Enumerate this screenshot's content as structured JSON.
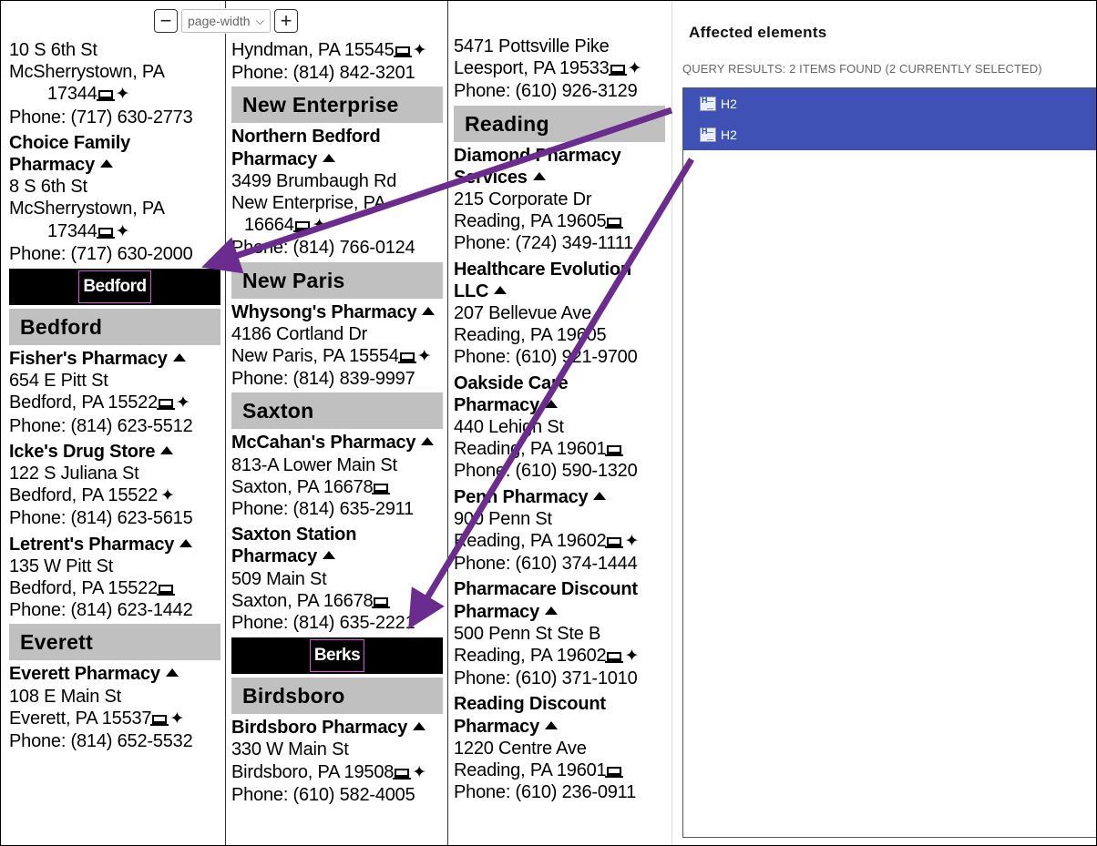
{
  "toolbar": {
    "zoom_out": "−",
    "zoom_value": "page-width",
    "zoom_in": "+"
  },
  "columns": {
    "col1": {
      "pre": [
        [
          "10 S 6th St",
          "",
          ""
        ],
        [
          "McSherrystown, PA",
          "",
          ""
        ],
        [
          "17344",
          "indent",
          "laptop+star"
        ],
        [
          "Phone: (717) 630-2773",
          "",
          ""
        ]
      ],
      "entry_choice": {
        "name1": "Choice Family",
        "name2": "Pharmacy",
        "addr": "8 S 6th St",
        "city": "McSherrystown, PA",
        "zip": "17344",
        "phone": "Phone: (717) 630-2000"
      },
      "county": "Bedford",
      "town_bedford": "Bedford",
      "fisher": {
        "name": "Fisher's Pharmacy",
        "addr": "654 E Pitt St",
        "city": "Bedford, PA 15522",
        "phone": "Phone: (814) 623-5512"
      },
      "icke": {
        "name": "Icke's Drug Store",
        "addr": "122 S Juliana St",
        "city": "Bedford, PA 15522",
        "phone": "Phone: (814) 623-5615"
      },
      "letrent": {
        "name": "Letrent's Pharmacy",
        "addr": "135 W Pitt St",
        "city": "Bedford, PA 15522",
        "phone": "Phone: (814) 623-1442"
      },
      "town_everett": "Everett",
      "everett": {
        "name": "Everett Pharmacy",
        "addr": "108 E Main St",
        "city": "Everett, PA 15537",
        "phone": "Phone: (814) 652-5532"
      }
    },
    "col2": {
      "hyndman_city": "Hyndman, PA 15545",
      "hyndman_phone": "Phone: (814) 842-3201",
      "town_new_enterprise": "New Enterprise",
      "northern": {
        "name1": "Northern Bedford",
        "name2": "Pharmacy",
        "addr": "3499 Brumbaugh Rd",
        "city": "New Enterprise, PA",
        "zip": "16664",
        "phone": "Phone: (814) 766-0124"
      },
      "town_new_paris": "New Paris",
      "whysong": {
        "name": "Whysong's Pharmacy",
        "addr": "4186 Cortland Dr",
        "city": "New Paris, PA 15554",
        "phone": "Phone: (814) 839-9997"
      },
      "town_saxton": "Saxton",
      "mccahan": {
        "name": "McCahan's Pharmacy",
        "addr": "813-A Lower Main St",
        "city": "Saxton, PA 16678",
        "phone": "Phone: (814) 635-2911"
      },
      "saxton_station": {
        "name1": "Saxton Station",
        "name2": "Pharmacy",
        "addr": "509 Main St",
        "city": "Saxton, PA 16678",
        "phone": "Phone: (814) 635-2221"
      },
      "county": "Berks",
      "town_birdsboro": "Birdsboro",
      "birdsboro": {
        "name": "Birdsboro Pharmacy",
        "addr": "330 W Main St",
        "city": "Birdsboro, PA 19508",
        "phone": "Phone: (610) 582-4005"
      }
    },
    "col3": {
      "top_addr": "5471 Pottsville Pike",
      "top_city": "Leesport, PA 19533",
      "top_phone": "Phone: (610) 926-3129",
      "town_reading": "Reading",
      "diamond": {
        "name1": "Diamond Pharmacy",
        "name2": "Services",
        "addr": "215 Corporate Dr",
        "city": "Reading, PA 19605",
        "phone": "Phone: (724) 349-1111"
      },
      "healthcare": {
        "name1": "Healthcare Evolution",
        "name2": "LLC",
        "addr": "207 Bellevue Ave",
        "city": "Reading, PA 19605",
        "phone": "Phone: (610) 921-9700"
      },
      "oakside": {
        "name1": "Oakside Care",
        "name2": "Pharmacy",
        "addr": "440 Lehigh St",
        "city": "Reading, PA 19601",
        "phone": "Phone: (610) 590-1320"
      },
      "penn": {
        "name": "Penn Pharmacy",
        "addr": "900 Penn St",
        "city": "Reading, PA 19602",
        "phone": "Phone: (610) 374-1444"
      },
      "pharmacare": {
        "name1": "Pharmacare Discount",
        "name2": "Pharmacy",
        "addr": "500 Penn St Ste B",
        "city": "Reading, PA 19602",
        "phone": "Phone: (610) 371-1010"
      },
      "reading_discount": {
        "name1": "Reading Discount",
        "name2": "Pharmacy",
        "addr": "1220 Centre Ave",
        "city": "Reading, PA 19601",
        "phone": "Phone: (610) 236-0911"
      }
    }
  },
  "panel": {
    "title": "Affected elements",
    "subtitle": "QUERY RESULTS: 2 ITEMS FOUND (2 CURRENTLY SELECTED)",
    "results": [
      {
        "label": "H2"
      },
      {
        "label": "H2"
      }
    ]
  },
  "colors": {
    "arrow": "#6a2c8e",
    "selection": "#3f51b5",
    "town_band": "#c0c0c0",
    "county_band": "#000000"
  }
}
